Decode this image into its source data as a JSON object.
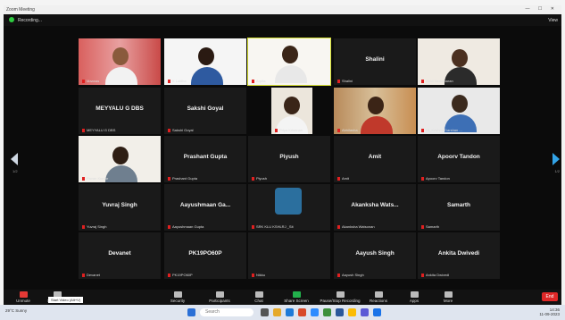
{
  "window": {
    "title": "Zoom Meeting",
    "controls": "— ☐ ✕"
  },
  "top_bar": {
    "recording": "Recording...",
    "view_label": "View"
  },
  "tiles": [
    {
      "name": "",
      "footer": "Maanas"
    },
    {
      "name": "",
      "footer": "K Lalitha"
    },
    {
      "name": "",
      "footer": "Arpita"
    },
    {
      "name": "Shalini",
      "footer": "Shalini"
    },
    {
      "name": "",
      "footer": "Akhil Nedumaran"
    },
    {
      "name": "MEYYALU G DBS",
      "footer": "MEYYALU G DBS"
    },
    {
      "name": "Sakshi Goyal",
      "footer": "Sakshi Goyal"
    },
    {
      "name": "",
      "footer": "Priya Krishnan"
    },
    {
      "name": "",
      "footer": "Abhilasha"
    },
    {
      "name": "",
      "footer": ""
    },
    {
      "name": "",
      "footer": "Gt_Krishna Darshan ..."
    },
    {
      "name": "",
      "footer": "Pavan Kumar"
    },
    {
      "name": "Prashant Gupta",
      "footer": "Prashant Gupta"
    },
    {
      "name": "Piyush",
      "footer": "Piyush"
    },
    {
      "name": "Amit",
      "footer": "Amit"
    },
    {
      "name": "Apoorv Tandon",
      "footer": "Apoorv Tandon"
    },
    {
      "name": "Yuvraj Singh",
      "footer": "Yuvraj Singh"
    },
    {
      "name": "Aayushmaan Ga...",
      "footer": "Aayushmaan Gupta"
    },
    {
      "name": "",
      "footer": "SRK KLU KSHLRJ _Sit"
    },
    {
      "name": "Akanksha Wats...",
      "footer": "Akanksha Watsonan"
    },
    {
      "name": "Samarth",
      "footer": "Samarth"
    },
    {
      "name": "Devanet",
      "footer": "Devanet"
    },
    {
      "name": "PK19PO60P",
      "footer": "PK19PO60P"
    },
    {
      "name": "",
      "footer": "Nikku"
    },
    {
      "name": "Aayush Singh",
      "footer": "Aayush Singh"
    },
    {
      "name": "Ankita Dwivedi",
      "footer": "Ankita Dwivedi"
    }
  ],
  "pager": {
    "left": "1/2",
    "right": "1/2"
  },
  "toolbar": {
    "mute": "Unmute",
    "stop_video": "Stop Video",
    "security": "Security",
    "participants": "Participants",
    "chat": "Chat",
    "share_screen": "Share Screen",
    "recording": "Pause/Stop Recording",
    "reactions": "Reactions",
    "apps": "Apps",
    "more": "More",
    "end": "End",
    "tooltip": "Start Video (Alt+V)"
  },
  "taskbar": {
    "weather": "29°C Sunny",
    "search": "Search",
    "time": "14:36",
    "date": "11-09-2023"
  },
  "colors": {
    "active_speaker": "#d7e034",
    "share": "#22b14c",
    "end": "#e02828"
  }
}
